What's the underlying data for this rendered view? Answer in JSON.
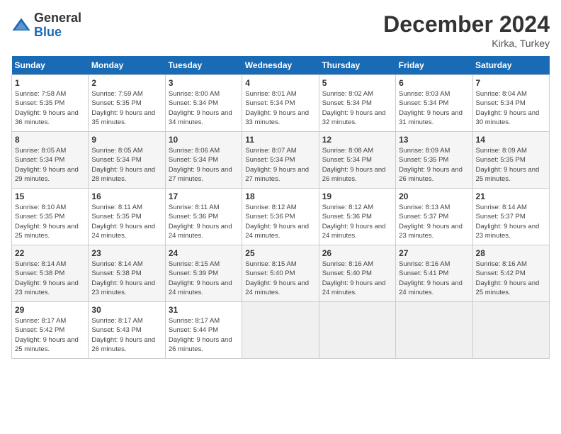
{
  "logo": {
    "general": "General",
    "blue": "Blue"
  },
  "header": {
    "month": "December 2024",
    "location": "Kirka, Turkey"
  },
  "weekdays": [
    "Sunday",
    "Monday",
    "Tuesday",
    "Wednesday",
    "Thursday",
    "Friday",
    "Saturday"
  ],
  "weeks": [
    [
      {
        "day": "1",
        "sunrise": "Sunrise: 7:58 AM",
        "sunset": "Sunset: 5:35 PM",
        "daylight": "Daylight: 9 hours and 36 minutes."
      },
      {
        "day": "2",
        "sunrise": "Sunrise: 7:59 AM",
        "sunset": "Sunset: 5:35 PM",
        "daylight": "Daylight: 9 hours and 35 minutes."
      },
      {
        "day": "3",
        "sunrise": "Sunrise: 8:00 AM",
        "sunset": "Sunset: 5:34 PM",
        "daylight": "Daylight: 9 hours and 34 minutes."
      },
      {
        "day": "4",
        "sunrise": "Sunrise: 8:01 AM",
        "sunset": "Sunset: 5:34 PM",
        "daylight": "Daylight: 9 hours and 33 minutes."
      },
      {
        "day": "5",
        "sunrise": "Sunrise: 8:02 AM",
        "sunset": "Sunset: 5:34 PM",
        "daylight": "Daylight: 9 hours and 32 minutes."
      },
      {
        "day": "6",
        "sunrise": "Sunrise: 8:03 AM",
        "sunset": "Sunset: 5:34 PM",
        "daylight": "Daylight: 9 hours and 31 minutes."
      },
      {
        "day": "7",
        "sunrise": "Sunrise: 8:04 AM",
        "sunset": "Sunset: 5:34 PM",
        "daylight": "Daylight: 9 hours and 30 minutes."
      }
    ],
    [
      {
        "day": "8",
        "sunrise": "Sunrise: 8:05 AM",
        "sunset": "Sunset: 5:34 PM",
        "daylight": "Daylight: 9 hours and 29 minutes."
      },
      {
        "day": "9",
        "sunrise": "Sunrise: 8:05 AM",
        "sunset": "Sunset: 5:34 PM",
        "daylight": "Daylight: 9 hours and 28 minutes."
      },
      {
        "day": "10",
        "sunrise": "Sunrise: 8:06 AM",
        "sunset": "Sunset: 5:34 PM",
        "daylight": "Daylight: 9 hours and 27 minutes."
      },
      {
        "day": "11",
        "sunrise": "Sunrise: 8:07 AM",
        "sunset": "Sunset: 5:34 PM",
        "daylight": "Daylight: 9 hours and 27 minutes."
      },
      {
        "day": "12",
        "sunrise": "Sunrise: 8:08 AM",
        "sunset": "Sunset: 5:34 PM",
        "daylight": "Daylight: 9 hours and 26 minutes."
      },
      {
        "day": "13",
        "sunrise": "Sunrise: 8:09 AM",
        "sunset": "Sunset: 5:35 PM",
        "daylight": "Daylight: 9 hours and 26 minutes."
      },
      {
        "day": "14",
        "sunrise": "Sunrise: 8:09 AM",
        "sunset": "Sunset: 5:35 PM",
        "daylight": "Daylight: 9 hours and 25 minutes."
      }
    ],
    [
      {
        "day": "15",
        "sunrise": "Sunrise: 8:10 AM",
        "sunset": "Sunset: 5:35 PM",
        "daylight": "Daylight: 9 hours and 25 minutes."
      },
      {
        "day": "16",
        "sunrise": "Sunrise: 8:11 AM",
        "sunset": "Sunset: 5:35 PM",
        "daylight": "Daylight: 9 hours and 24 minutes."
      },
      {
        "day": "17",
        "sunrise": "Sunrise: 8:11 AM",
        "sunset": "Sunset: 5:36 PM",
        "daylight": "Daylight: 9 hours and 24 minutes."
      },
      {
        "day": "18",
        "sunrise": "Sunrise: 8:12 AM",
        "sunset": "Sunset: 5:36 PM",
        "daylight": "Daylight: 9 hours and 24 minutes."
      },
      {
        "day": "19",
        "sunrise": "Sunrise: 8:12 AM",
        "sunset": "Sunset: 5:36 PM",
        "daylight": "Daylight: 9 hours and 24 minutes."
      },
      {
        "day": "20",
        "sunrise": "Sunrise: 8:13 AM",
        "sunset": "Sunset: 5:37 PM",
        "daylight": "Daylight: 9 hours and 23 minutes."
      },
      {
        "day": "21",
        "sunrise": "Sunrise: 8:14 AM",
        "sunset": "Sunset: 5:37 PM",
        "daylight": "Daylight: 9 hours and 23 minutes."
      }
    ],
    [
      {
        "day": "22",
        "sunrise": "Sunrise: 8:14 AM",
        "sunset": "Sunset: 5:38 PM",
        "daylight": "Daylight: 9 hours and 23 minutes."
      },
      {
        "day": "23",
        "sunrise": "Sunrise: 8:14 AM",
        "sunset": "Sunset: 5:38 PM",
        "daylight": "Daylight: 9 hours and 23 minutes."
      },
      {
        "day": "24",
        "sunrise": "Sunrise: 8:15 AM",
        "sunset": "Sunset: 5:39 PM",
        "daylight": "Daylight: 9 hours and 24 minutes."
      },
      {
        "day": "25",
        "sunrise": "Sunrise: 8:15 AM",
        "sunset": "Sunset: 5:40 PM",
        "daylight": "Daylight: 9 hours and 24 minutes."
      },
      {
        "day": "26",
        "sunrise": "Sunrise: 8:16 AM",
        "sunset": "Sunset: 5:40 PM",
        "daylight": "Daylight: 9 hours and 24 minutes."
      },
      {
        "day": "27",
        "sunrise": "Sunrise: 8:16 AM",
        "sunset": "Sunset: 5:41 PM",
        "daylight": "Daylight: 9 hours and 24 minutes."
      },
      {
        "day": "28",
        "sunrise": "Sunrise: 8:16 AM",
        "sunset": "Sunset: 5:42 PM",
        "daylight": "Daylight: 9 hours and 25 minutes."
      }
    ],
    [
      {
        "day": "29",
        "sunrise": "Sunrise: 8:17 AM",
        "sunset": "Sunset: 5:42 PM",
        "daylight": "Daylight: 9 hours and 25 minutes."
      },
      {
        "day": "30",
        "sunrise": "Sunrise: 8:17 AM",
        "sunset": "Sunset: 5:43 PM",
        "daylight": "Daylight: 9 hours and 26 minutes."
      },
      {
        "day": "31",
        "sunrise": "Sunrise: 8:17 AM",
        "sunset": "Sunset: 5:44 PM",
        "daylight": "Daylight: 9 hours and 26 minutes."
      },
      null,
      null,
      null,
      null
    ]
  ]
}
